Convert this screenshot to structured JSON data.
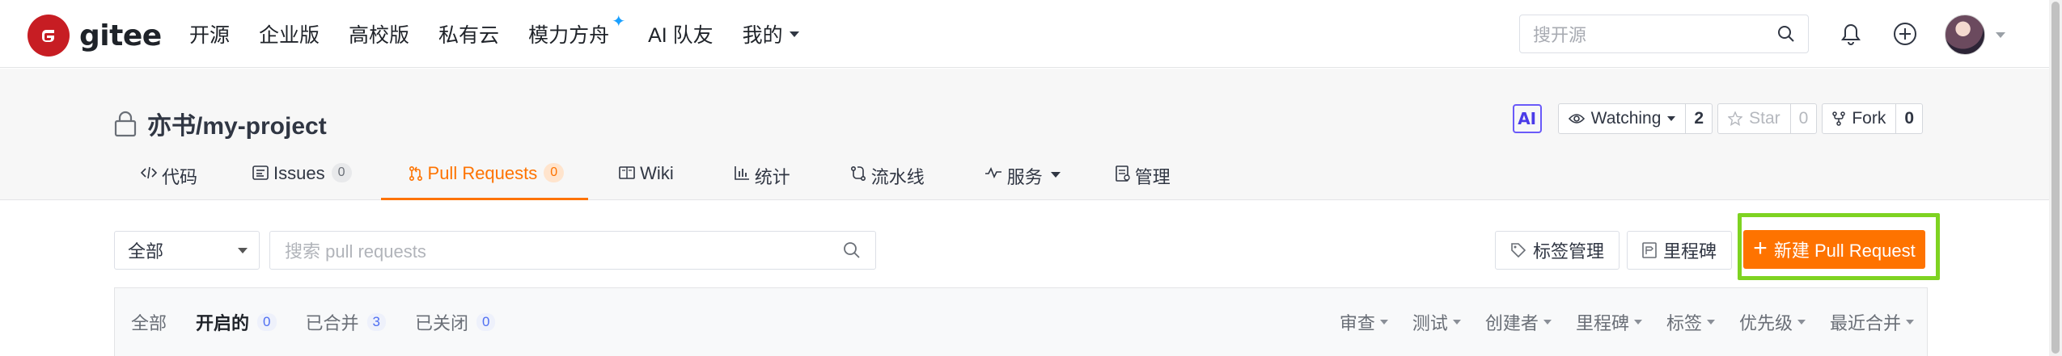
{
  "topbar": {
    "logo_text": "gitee",
    "nav": [
      "开源",
      "企业版",
      "高校版",
      "私有云",
      "模力方舟",
      "AI 队友",
      "我的"
    ],
    "search_placeholder": "搜开源"
  },
  "project": {
    "title": "亦书/my-project",
    "ai_label": "AI",
    "watch": {
      "label": "Watching",
      "count": "2"
    },
    "star": {
      "label": "Star",
      "count": "0"
    },
    "fork": {
      "label": "Fork",
      "count": "0"
    },
    "tabs": [
      {
        "label": "代码",
        "icon": "code-icon"
      },
      {
        "label": "Issues",
        "icon": "issues-icon",
        "count": "0"
      },
      {
        "label": "Pull Requests",
        "icon": "pull-request-icon",
        "count": "0",
        "active": true
      },
      {
        "label": "Wiki",
        "icon": "wiki-icon"
      },
      {
        "label": "统计",
        "icon": "chart-icon"
      },
      {
        "label": "流水线",
        "icon": "pipeline-icon"
      },
      {
        "label": "服务",
        "icon": "service-icon"
      },
      {
        "label": "管理",
        "icon": "manage-icon"
      }
    ]
  },
  "pr_toolbar": {
    "filter_value": "全部",
    "search_placeholder": "搜索 pull requests",
    "labels_button": "标签管理",
    "milestones_button": "里程碑",
    "new_pr_button": "新建 Pull Request"
  },
  "pr_list": {
    "states": [
      {
        "label": "全部"
      },
      {
        "label": "开启的",
        "count": "0",
        "active": true
      },
      {
        "label": "已合并",
        "count": "3"
      },
      {
        "label": "已关闭",
        "count": "0"
      }
    ],
    "filters": [
      "审查",
      "测试",
      "创建者",
      "里程碑",
      "标签",
      "优先级",
      "最近合并"
    ]
  },
  "colors": {
    "accent": "#fe7300",
    "brand": "#c71d23",
    "highlight": "#7ed321"
  }
}
